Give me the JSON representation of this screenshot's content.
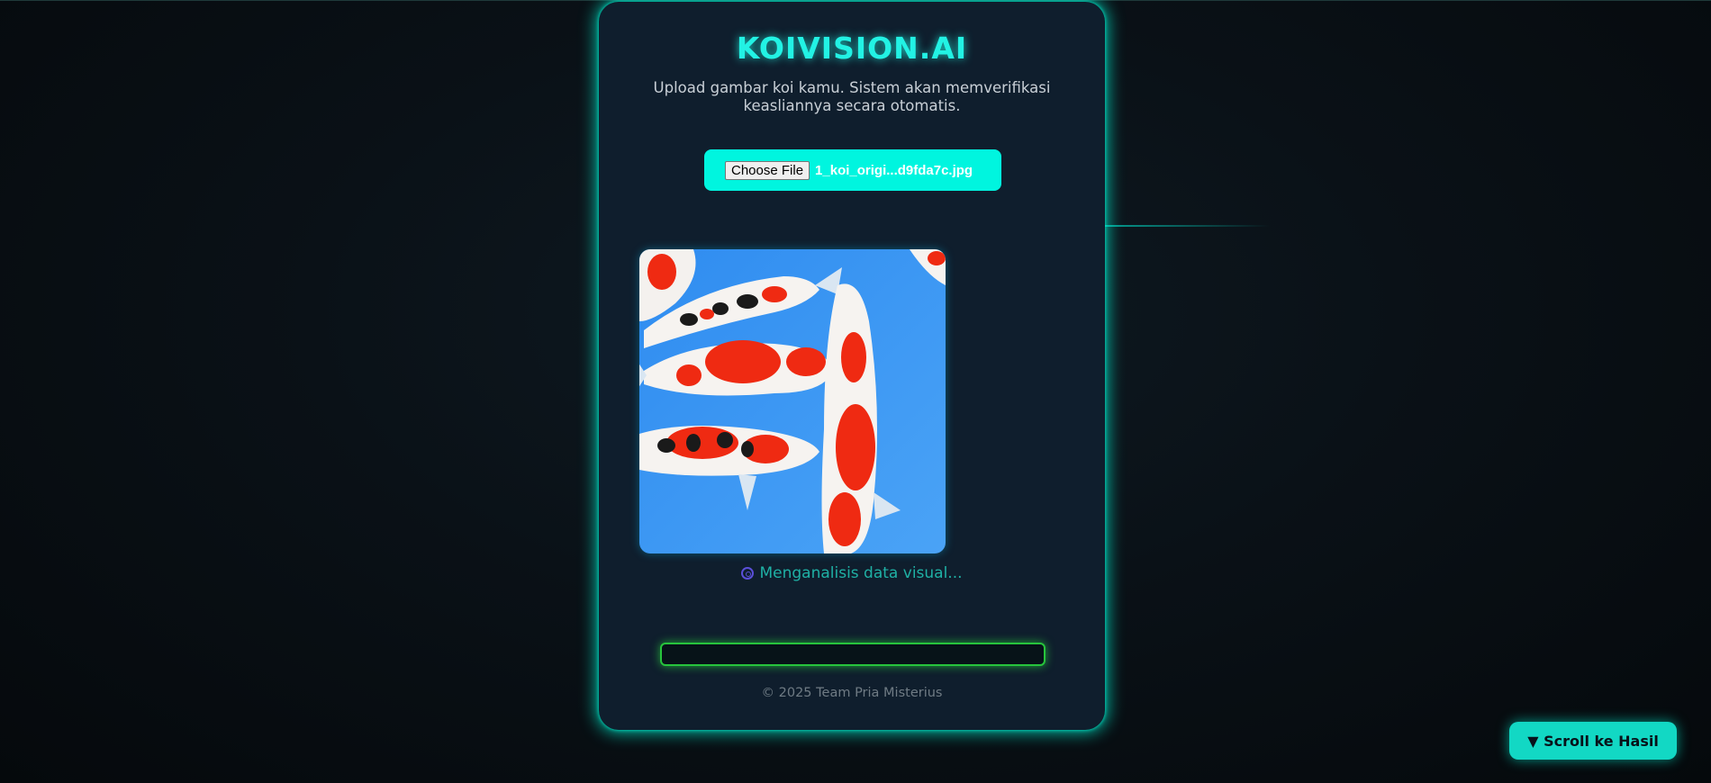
{
  "app": {
    "title": "KOIVISION.AI",
    "subtitle": "Upload gambar koi kamu. Sistem akan memverifikasi keasliannya secara otomatis."
  },
  "upload": {
    "button_label": "Choose File",
    "file_name": "1_koi_origi...d9fda7c.jpg"
  },
  "preview": {
    "icon": "koi-image"
  },
  "status": {
    "icon": "spinner-icon",
    "text": "Menganalisis data visual..."
  },
  "progress": {
    "value": 0
  },
  "footer": {
    "text": "© 2025 Team Pria Misterius"
  },
  "scroll_button": {
    "label": "▼ Scroll ke Hasil"
  },
  "colors": {
    "accent": "#22f2e4",
    "card_bg": "#0f1e2d",
    "progress": "#27c43c"
  }
}
